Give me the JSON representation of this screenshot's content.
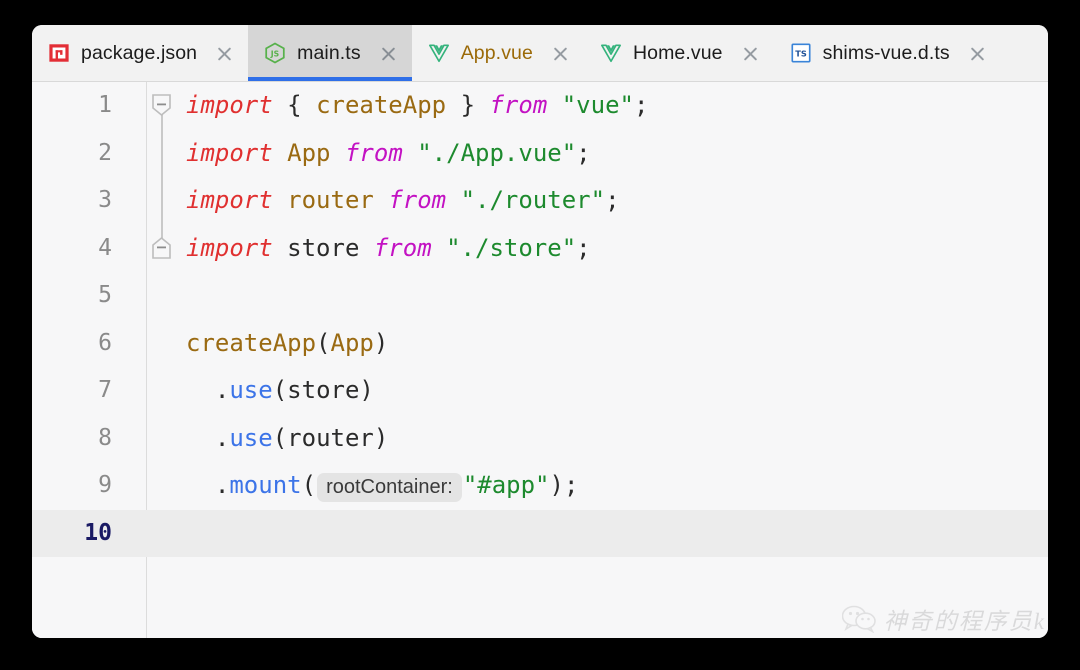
{
  "window": {
    "background": "#000000",
    "surface": "#f7f7f8",
    "tabbar_background": "#f2f2f2",
    "active_tab_background": "#d6d6d6",
    "active_tab_underline": "#2f6fe8",
    "current_line_background": "#ececec"
  },
  "tabs": [
    {
      "label": "package.json",
      "icon": "npm-icon",
      "active": false,
      "modified": false,
      "close_label": "close"
    },
    {
      "label": "main.ts",
      "icon": "js-icon",
      "active": true,
      "modified": false,
      "close_label": "close"
    },
    {
      "label": "App.vue",
      "icon": "vue-icon",
      "active": false,
      "modified": true,
      "close_label": "close"
    },
    {
      "label": "Home.vue",
      "icon": "vue-icon",
      "active": false,
      "modified": false,
      "close_label": "close"
    },
    {
      "label": "shims-vue.d.ts",
      "icon": "ts-icon",
      "active": false,
      "modified": false,
      "close_label": "close"
    }
  ],
  "editor": {
    "language": "typescript",
    "current_line": 10,
    "lines": [
      {
        "number": "1",
        "fold": "start",
        "tokens": [
          {
            "text": "import",
            "type": "keyword"
          },
          {
            "text": " ",
            "type": "plain"
          },
          {
            "text": "{",
            "type": "punct"
          },
          {
            "text": " ",
            "type": "plain"
          },
          {
            "text": "createApp",
            "type": "identifier"
          },
          {
            "text": " ",
            "type": "plain"
          },
          {
            "text": "}",
            "type": "punct"
          },
          {
            "text": " ",
            "type": "plain"
          },
          {
            "text": "from",
            "type": "from"
          },
          {
            "text": " ",
            "type": "plain"
          },
          {
            "text": "\"vue\"",
            "type": "string"
          },
          {
            "text": ";",
            "type": "punct"
          }
        ]
      },
      {
        "number": "2",
        "fold": "line",
        "tokens": [
          {
            "text": "import",
            "type": "keyword"
          },
          {
            "text": " ",
            "type": "plain"
          },
          {
            "text": "App",
            "type": "identifier"
          },
          {
            "text": " ",
            "type": "plain"
          },
          {
            "text": "from",
            "type": "from"
          },
          {
            "text": " ",
            "type": "plain"
          },
          {
            "text": "\"./App.vue\"",
            "type": "string"
          },
          {
            "text": ";",
            "type": "punct"
          }
        ]
      },
      {
        "number": "3",
        "fold": "line",
        "tokens": [
          {
            "text": "import",
            "type": "keyword"
          },
          {
            "text": " ",
            "type": "plain"
          },
          {
            "text": "router",
            "type": "identifier"
          },
          {
            "text": " ",
            "type": "plain"
          },
          {
            "text": "from",
            "type": "from"
          },
          {
            "text": " ",
            "type": "plain"
          },
          {
            "text": "\"./router\"",
            "type": "string"
          },
          {
            "text": ";",
            "type": "punct"
          }
        ]
      },
      {
        "number": "4",
        "fold": "end",
        "tokens": [
          {
            "text": "import",
            "type": "keyword"
          },
          {
            "text": " ",
            "type": "plain"
          },
          {
            "text": "store",
            "type": "plain"
          },
          {
            "text": " ",
            "type": "plain"
          },
          {
            "text": "from",
            "type": "from"
          },
          {
            "text": " ",
            "type": "plain"
          },
          {
            "text": "\"./store\"",
            "type": "string"
          },
          {
            "text": ";",
            "type": "punct"
          }
        ]
      },
      {
        "number": "5",
        "fold": "none",
        "tokens": []
      },
      {
        "number": "6",
        "fold": "none",
        "tokens": [
          {
            "text": "createApp",
            "type": "identifier"
          },
          {
            "text": "(",
            "type": "punct"
          },
          {
            "text": "App",
            "type": "identifier"
          },
          {
            "text": ")",
            "type": "punct"
          }
        ]
      },
      {
        "number": "7",
        "fold": "none",
        "tokens": [
          {
            "text": "  .",
            "type": "punct"
          },
          {
            "text": "use",
            "type": "method"
          },
          {
            "text": "(",
            "type": "punct"
          },
          {
            "text": "store",
            "type": "plain"
          },
          {
            "text": ")",
            "type": "punct"
          }
        ]
      },
      {
        "number": "8",
        "fold": "none",
        "tokens": [
          {
            "text": "  .",
            "type": "punct"
          },
          {
            "text": "use",
            "type": "method"
          },
          {
            "text": "(",
            "type": "punct"
          },
          {
            "text": "router",
            "type": "plain"
          },
          {
            "text": ")",
            "type": "punct"
          }
        ]
      },
      {
        "number": "9",
        "fold": "none",
        "tokens": [
          {
            "text": "  .",
            "type": "punct"
          },
          {
            "text": "mount",
            "type": "method"
          },
          {
            "text": "(",
            "type": "punct"
          },
          {
            "text": "rootContainer:",
            "type": "inlay"
          },
          {
            "text": "\"#app\"",
            "type": "string"
          },
          {
            "text": ")",
            "type": "punct"
          },
          {
            "text": ";",
            "type": "punct"
          }
        ]
      },
      {
        "number": "10",
        "fold": "none",
        "current": true,
        "tokens": []
      }
    ]
  },
  "watermark": {
    "text": "神奇的程序员k",
    "icon": "wechat-icon"
  }
}
